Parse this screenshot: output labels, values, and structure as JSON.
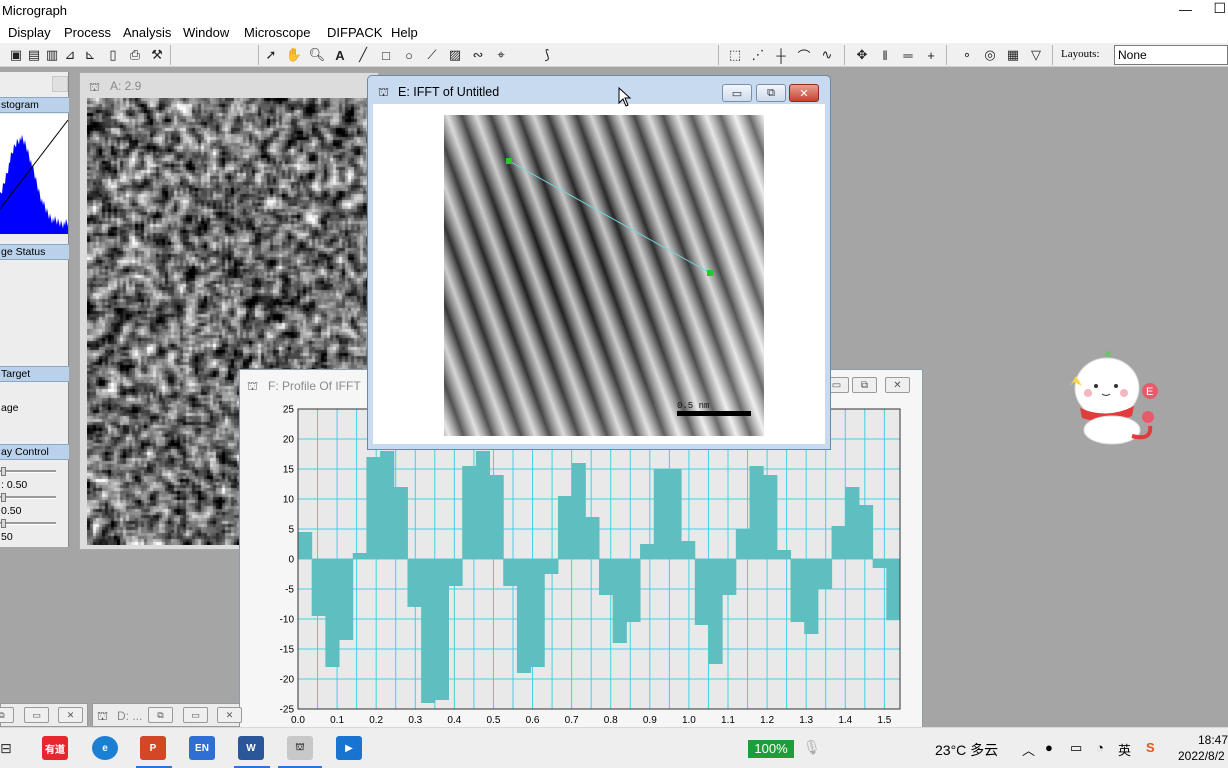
{
  "app": {
    "title": "Micrograph",
    "min_glyph": "—",
    "max_glyph": "☐"
  },
  "menu": [
    "Display",
    "Process",
    "Analysis",
    "Window",
    "Microscope",
    "DIFPACK",
    "Help"
  ],
  "toolbar": {
    "layouts_label": "Layouts:",
    "layouts_value": "None"
  },
  "left_panel": {
    "histogram_header": "stogram",
    "image_status_header": "ge Status",
    "target_header": "Target",
    "target_text": "age",
    "display_control_header": "ay Control",
    "slider_values": [
      ": 0.50",
      "0.50",
      "50"
    ],
    "histogram_color": "#0000ff"
  },
  "windows": {
    "A": {
      "title": "A: 2.9"
    },
    "E": {
      "title": "E: IFFT of Untitled",
      "scale_bar": "0.5 nm",
      "line_color": "#6fd6e0",
      "marker_color": "#22cc22"
    },
    "F": {
      "title": "F: Profile Of IFFT"
    },
    "D": {
      "title": "D: ..."
    }
  },
  "chart_data": {
    "type": "bar",
    "title": "",
    "xlabel": "",
    "ylabel": "",
    "xlim": [
      0.0,
      1.54
    ],
    "ylim": [
      -25,
      25
    ],
    "x_ticks": [
      "0.0",
      "0.1",
      "0.2",
      "0.3",
      "0.4",
      "0.5",
      "0.6",
      "0.7",
      "0.8",
      "0.9",
      "1.0",
      "1.1",
      "1.2",
      "1.3",
      "1.4",
      "1.5"
    ],
    "y_ticks": [
      "25",
      "20",
      "15",
      "10",
      "5",
      "0",
      "-5",
      "-10",
      "-15",
      "-20",
      "-25"
    ],
    "bar_width": 0.033,
    "values": [
      4.5,
      -9.5,
      -18,
      -13.5,
      1,
      17,
      18,
      12,
      -8,
      -24,
      -23.5,
      -4.5,
      15.5,
      18,
      14,
      -4.5,
      -19,
      -18,
      -2.5,
      10.5,
      16,
      7,
      -6,
      -14,
      -10.5,
      2.5,
      15,
      15,
      3,
      -11,
      -17.5,
      -6,
      5,
      15.5,
      14,
      1.5,
      -10.5,
      -12.5,
      -5,
      5.5,
      12,
      9,
      -1.5,
      -10.2
    ],
    "grid": true,
    "bar_color": "#5fbfc0",
    "grid_color": "#43d1e0",
    "plot_bg": "#e9e9ea"
  },
  "taskbar": {
    "zoom": "100%",
    "weather": "23°C 多云",
    "tray": [
      "英"
    ],
    "time": "18:47",
    "date": "2022/8/2",
    "apps": [
      "有道",
      "Edge",
      "PowerPoint",
      "EN",
      "Word",
      "DigitalMicrograph",
      "Video"
    ]
  },
  "mascot": {
    "badge": "E"
  }
}
